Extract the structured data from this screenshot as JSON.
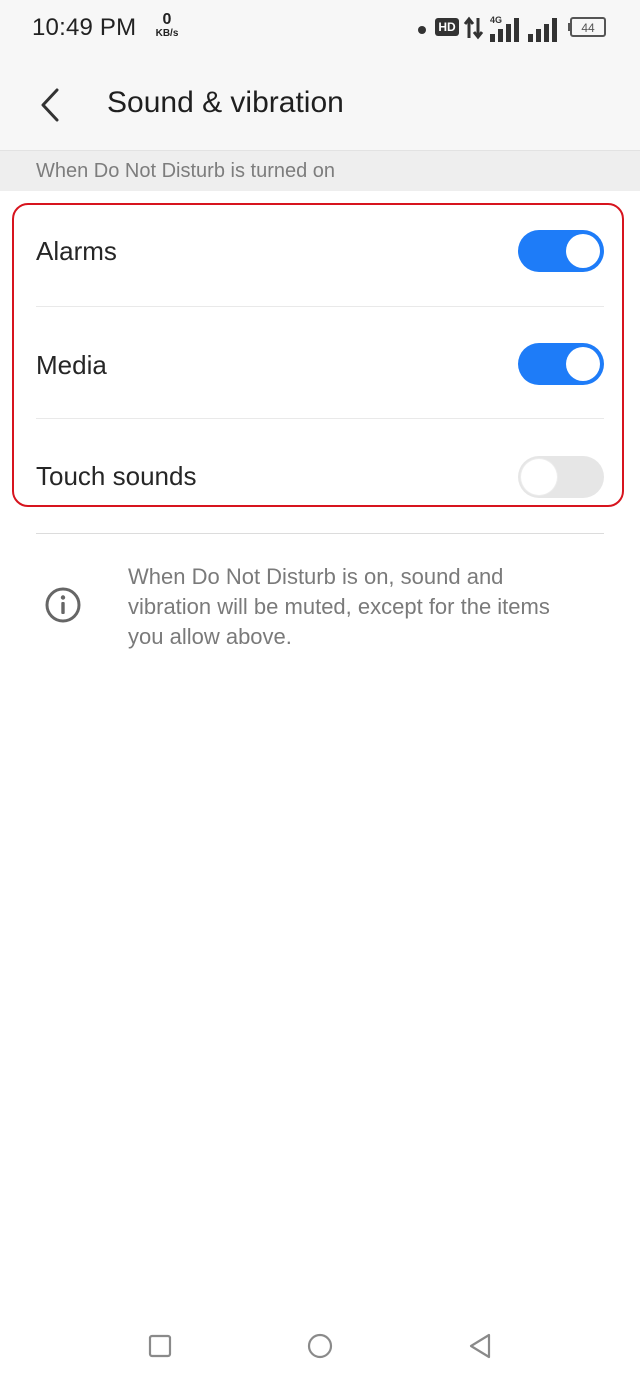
{
  "status_bar": {
    "time": "10:49 PM",
    "net_speed_value": "0",
    "net_speed_unit": "KB/s",
    "hd_label": "HD",
    "network_label": "4G",
    "battery_level": "44"
  },
  "header": {
    "title": "Sound & vibration"
  },
  "section": {
    "title": "When Do Not Disturb is turned on"
  },
  "settings": [
    {
      "label": "Alarms",
      "enabled": true
    },
    {
      "label": "Media",
      "enabled": true
    },
    {
      "label": "Touch sounds",
      "enabled": false
    }
  ],
  "info": {
    "text": "When Do Not Disturb is on, sound and vibration will be muted, except for the items you allow above."
  },
  "colors": {
    "toggle_on": "#1e7cf8",
    "toggle_off": "#e6e6e6",
    "highlight_border": "#d7141e"
  }
}
